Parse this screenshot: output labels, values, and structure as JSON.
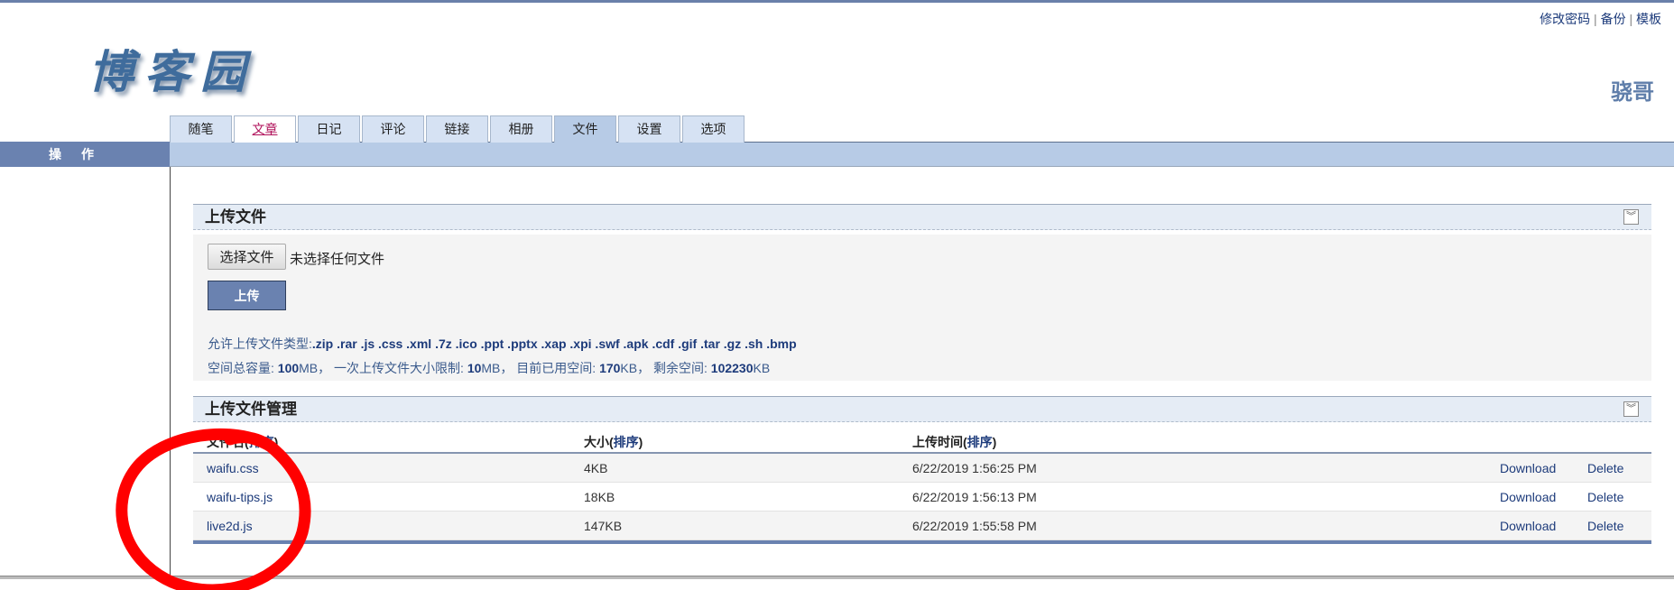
{
  "header": {
    "top_links": [
      "修改密码",
      "备份",
      "模板"
    ],
    "separator": "|",
    "logo_text": "博客园",
    "username": "骁哥"
  },
  "tabs": [
    {
      "label": "随笔",
      "state": "normal"
    },
    {
      "label": "文章",
      "state": "link"
    },
    {
      "label": "日记",
      "state": "normal"
    },
    {
      "label": "评论",
      "state": "normal"
    },
    {
      "label": "链接",
      "state": "normal"
    },
    {
      "label": "相册",
      "state": "normal"
    },
    {
      "label": "文件",
      "state": "active"
    },
    {
      "label": "设置",
      "state": "normal"
    },
    {
      "label": "选项",
      "state": "normal"
    }
  ],
  "sidebar": {
    "title": "操作"
  },
  "upload": {
    "title": "上传文件",
    "choose_button": "选择文件",
    "no_file": "未选择任何文件",
    "upload_button": "上传",
    "allowed_label": "允许上传文件类型:",
    "allowed_types": ".zip .rar .js .css .xml .7z .ico .ppt .pptx .xap .xpi .swf .apk .cdf .gif .tar .gz .sh .bmp",
    "quota": {
      "total_label": "空间总容量: ",
      "total_value": "100",
      "total_unit": "MB，",
      "limit_label": " 一次上传文件大小限制: ",
      "limit_value": "10",
      "limit_unit": "MB，",
      "used_label": " 目前已用空间: ",
      "used_value": "170",
      "used_unit": "KB，",
      "free_label": " 剩余空间: ",
      "free_value": "102230",
      "free_unit": "KB"
    }
  },
  "manage": {
    "title": "上传文件管理",
    "columns": [
      {
        "label": "文件名",
        "sort": "排序"
      },
      {
        "label": "大小",
        "sort": "排序"
      },
      {
        "label": "上传时间",
        "sort": "排序"
      }
    ],
    "rows": [
      {
        "name": "waifu.css",
        "size": "4KB",
        "time": "6/22/2019 1:56:25 PM",
        "download": "Download",
        "delete": "Delete"
      },
      {
        "name": "waifu-tips.js",
        "size": "18KB",
        "time": "6/22/2019 1:56:13 PM",
        "download": "Download",
        "delete": "Delete"
      },
      {
        "name": "live2d.js",
        "size": "147KB",
        "time": "6/22/2019 1:55:58 PM",
        "download": "Download",
        "delete": "Delete"
      }
    ]
  },
  "colors": {
    "accent": "#6a82b0",
    "nav_bar": "#b7cbe6",
    "annotation": "#ff0000"
  }
}
